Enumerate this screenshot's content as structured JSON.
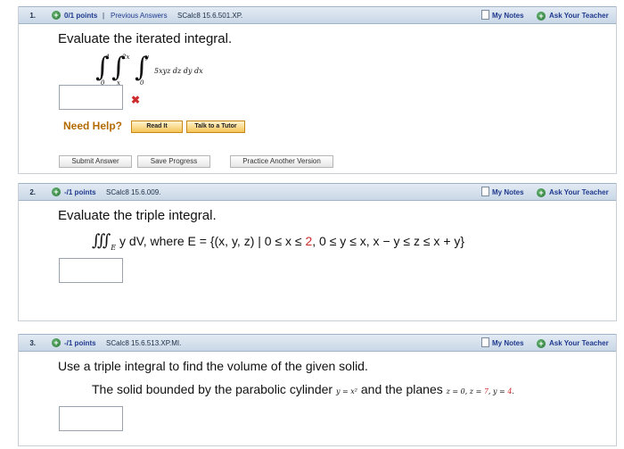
{
  "q1": {
    "number": "1.",
    "points": "0/1 points",
    "separator": "|",
    "previous_answers": "Previous Answers",
    "source": "SCalc8 15.6.501.XP.",
    "my_notes": "My Notes",
    "ask_teacher": "Ask Your Teacher",
    "prompt": "Evaluate the iterated integral.",
    "integral": {
      "upper1": "1",
      "lower1": "0",
      "upper2": "2x",
      "lower2": "x",
      "upper3": "y",
      "lower3": "0",
      "integrand": "5xyz dz dy dx"
    },
    "answer_value": "",
    "incorrect_mark": "✖",
    "need_help": "Need Help?",
    "read_it": "Read It",
    "talk_tutor": "Talk to a Tutor",
    "submit_answer": "Submit Answer",
    "save_progress": "Save Progress",
    "practice_another": "Practice Another Version"
  },
  "q2": {
    "number": "2.",
    "points": "-/1 points",
    "source": "SCalc8 15.6.009.",
    "my_notes": "My Notes",
    "ask_teacher": "Ask Your Teacher",
    "prompt": "Evaluate the triple integral.",
    "integral_symbol": "∭",
    "region_sub": "E",
    "expr_a": "y dV, where E = {(x, y, z) | 0 ≤ x ≤ ",
    "expr_red": "2",
    "expr_b": ", 0 ≤ y ≤ x, x − y ≤ z ≤ x + y}",
    "answer_value": ""
  },
  "q3": {
    "number": "3.",
    "points": "-/1 points",
    "source": "SCalc8 15.6.513.XP.MI.",
    "my_notes": "My Notes",
    "ask_teacher": "Ask Your Teacher",
    "prompt": "Use a triple integral to find the volume of the given solid.",
    "desc_a": "The solid bounded by the parabolic cylinder ",
    "cylinder": "y = x²",
    "desc_b": " and the planes ",
    "planes_a": "z = 0, z = ",
    "planes_red1": "7",
    "planes_b": ", y = ",
    "planes_red2": "4",
    "planes_end": ".",
    "answer_value": ""
  },
  "colors": {
    "accent": "#1f3a8f",
    "bar": "#c9d7e6",
    "incorrect": "#cc2b2b",
    "help": "#b36a00"
  }
}
